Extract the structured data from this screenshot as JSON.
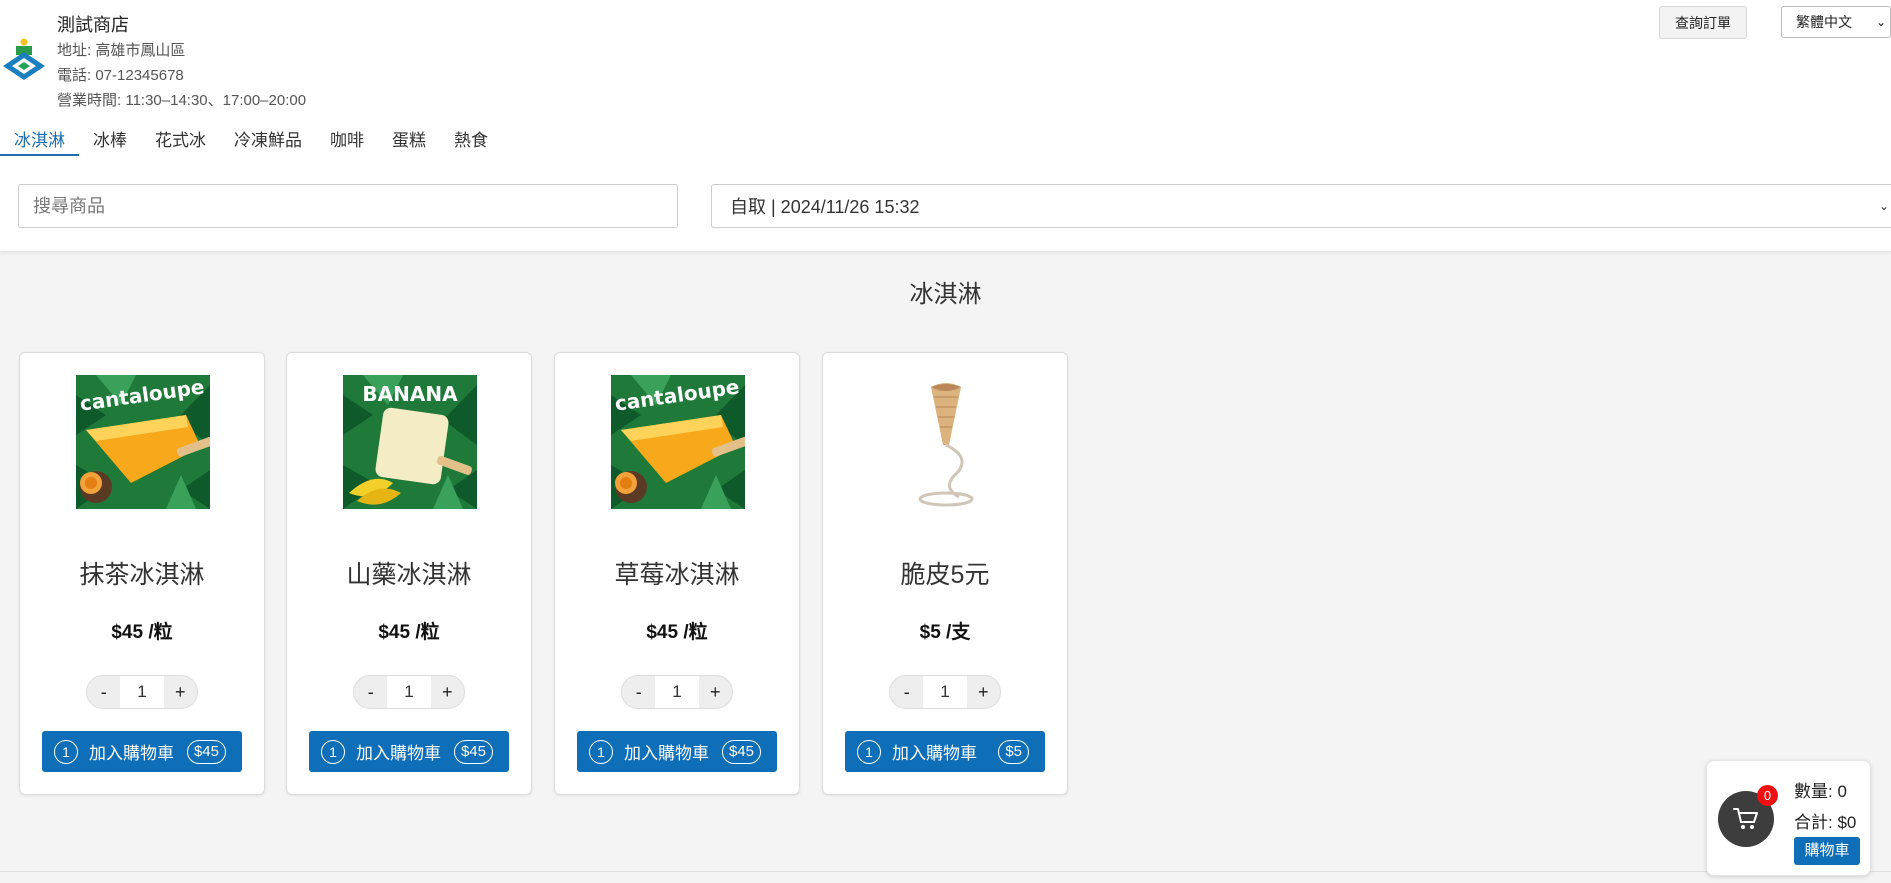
{
  "store": {
    "name": "測試商店",
    "address": "地址: 高雄市鳳山區",
    "phone": "電話: 07-12345678",
    "hours": "營業時間: 11:30–14:30、17:00–20:00"
  },
  "header": {
    "order_query_label": "查詢訂單",
    "language_selected": "繁體中文"
  },
  "tabs": [
    {
      "label": "冰淇淋",
      "active": true
    },
    {
      "label": "冰棒",
      "active": false
    },
    {
      "label": "花式冰",
      "active": false
    },
    {
      "label": "冷凍鮮品",
      "active": false
    },
    {
      "label": "咖啡",
      "active": false
    },
    {
      "label": "蛋糕",
      "active": false
    },
    {
      "label": "熱食",
      "active": false
    }
  ],
  "search": {
    "placeholder": "搜尋商品"
  },
  "pickup": {
    "selected": "自取 | 2024/11/26 15:32"
  },
  "section": {
    "title": "冰淇淋"
  },
  "products": [
    {
      "name": "抹茶冰淇淋",
      "price": "$45 /粒",
      "quantity": "1",
      "add_label": "加入購物車",
      "add_count": "1",
      "add_price": "$45",
      "image": "cantaloupe-popsicle",
      "image_text": "cantaloupe"
    },
    {
      "name": "山藥冰淇淋",
      "price": "$45 /粒",
      "quantity": "1",
      "add_label": "加入購物車",
      "add_count": "1",
      "add_price": "$45",
      "image": "banana-popsicle",
      "image_text": "BANANA"
    },
    {
      "name": "草莓冰淇淋",
      "price": "$45 /粒",
      "quantity": "1",
      "add_label": "加入購物車",
      "add_count": "1",
      "add_price": "$45",
      "image": "cantaloupe-popsicle",
      "image_text": "cantaloupe"
    },
    {
      "name": "脆皮5元",
      "price": "$5 /支",
      "quantity": "1",
      "add_label": "加入購物車",
      "add_count": "1",
      "add_price": "$5",
      "image": "cone-on-stand",
      "image_text": ""
    }
  ],
  "stepper": {
    "minus": "-",
    "plus": "+"
  },
  "cart": {
    "badge": "0",
    "quantity": "數量: 0",
    "total": "合計: $0",
    "button_label": "購物車"
  },
  "colors": {
    "accent": "#0e6eb8",
    "tab_active": "#1e6fb0",
    "badge": "#ee1111",
    "page_bg": "#f4f4f4"
  }
}
